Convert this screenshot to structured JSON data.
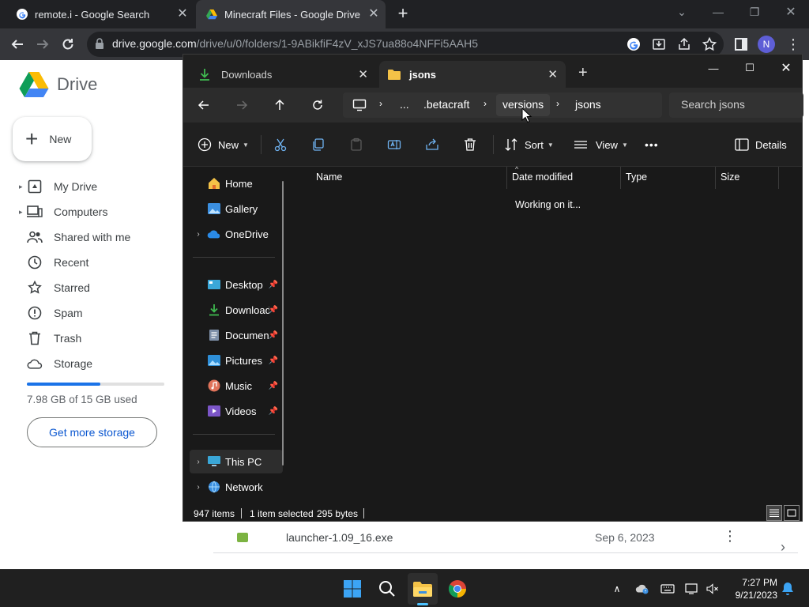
{
  "chrome": {
    "tabs": [
      {
        "title": "remote.i - Google Search",
        "favicon": "google-g-icon",
        "active": false
      },
      {
        "title": "Minecraft Files - Google Drive",
        "favicon": "google-drive-icon",
        "active": true
      }
    ],
    "url_host": "drive.google.com",
    "url_path": "/drive/u/0/folders/1-9ABikfiF4zV_xJS7ua88o4NFFi5AAH5",
    "profile_initial": "N"
  },
  "drive": {
    "product_name": "Drive",
    "new_label": "New",
    "nav": [
      {
        "label": "My Drive",
        "icon": "my-drive-icon",
        "expandable": true
      },
      {
        "label": "Computers",
        "icon": "computers-icon",
        "expandable": true
      },
      {
        "label": "Shared with me",
        "icon": "shared-icon",
        "expandable": false
      },
      {
        "label": "Recent",
        "icon": "clock-icon",
        "expandable": false
      },
      {
        "label": "Starred",
        "icon": "star-icon",
        "expandable": false
      },
      {
        "label": "Spam",
        "icon": "spam-icon",
        "expandable": false
      },
      {
        "label": "Trash",
        "icon": "trash-icon",
        "expandable": false
      },
      {
        "label": "Storage",
        "icon": "cloud-icon",
        "expandable": false
      }
    ],
    "storage_text": "7.98 GB of 15 GB used",
    "storage_fraction": 0.532,
    "get_storage_label": "Get more storage",
    "visible_file": {
      "name": "launcher-1.09_16.exe",
      "modified": "Sep 6, 2023"
    }
  },
  "explorer": {
    "tabs": [
      {
        "title": "Downloads",
        "icon": "download-icon",
        "active": false
      },
      {
        "title": "jsons",
        "icon": "folder-icon",
        "active": true
      }
    ],
    "breadcrumb": [
      "...",
      ".betacraft",
      "versions",
      "jsons"
    ],
    "search_placeholder": "Search jsons",
    "commands": {
      "new": "New",
      "sort": "Sort",
      "view": "View",
      "more": "•••",
      "details": "Details"
    },
    "nav_items": [
      {
        "label": "Home",
        "icon": "home-icon",
        "expandable": false,
        "pinned": false,
        "selected": false
      },
      {
        "label": "Gallery",
        "icon": "gallery-icon",
        "expandable": false,
        "pinned": false,
        "selected": false
      },
      {
        "label": "OneDrive",
        "icon": "onedrive-icon",
        "expandable": true,
        "pinned": false,
        "selected": false
      },
      {
        "label": "Desktop",
        "icon": "desktop-icon",
        "expandable": false,
        "pinned": true,
        "selected": false
      },
      {
        "label": "Downloads",
        "icon": "download-icon",
        "expandable": false,
        "pinned": true,
        "selected": false
      },
      {
        "label": "Documents",
        "icon": "documents-icon",
        "expandable": false,
        "pinned": true,
        "selected": false
      },
      {
        "label": "Pictures",
        "icon": "pictures-icon",
        "expandable": false,
        "pinned": true,
        "selected": false
      },
      {
        "label": "Music",
        "icon": "music-icon",
        "expandable": false,
        "pinned": true,
        "selected": false
      },
      {
        "label": "Videos",
        "icon": "videos-icon",
        "expandable": false,
        "pinned": true,
        "selected": false
      },
      {
        "label": "This PC",
        "icon": "this-pc-icon",
        "expandable": true,
        "pinned": false,
        "selected": true
      },
      {
        "label": "Network",
        "icon": "network-icon",
        "expandable": true,
        "pinned": false,
        "selected": false
      }
    ],
    "columns": [
      "Name",
      "Date modified",
      "Type",
      "Size"
    ],
    "loading_text": "Working on it...",
    "status": {
      "items": "947 items",
      "selected": "1 item selected",
      "size": "295 bytes"
    }
  },
  "taskbar": {
    "time": "7:27 PM",
    "date": "9/21/2023"
  },
  "colors": {
    "drive_blue": "#1a73e8",
    "explorer_bg": "#191919",
    "taskbar_accent": "#4cc2ff"
  }
}
